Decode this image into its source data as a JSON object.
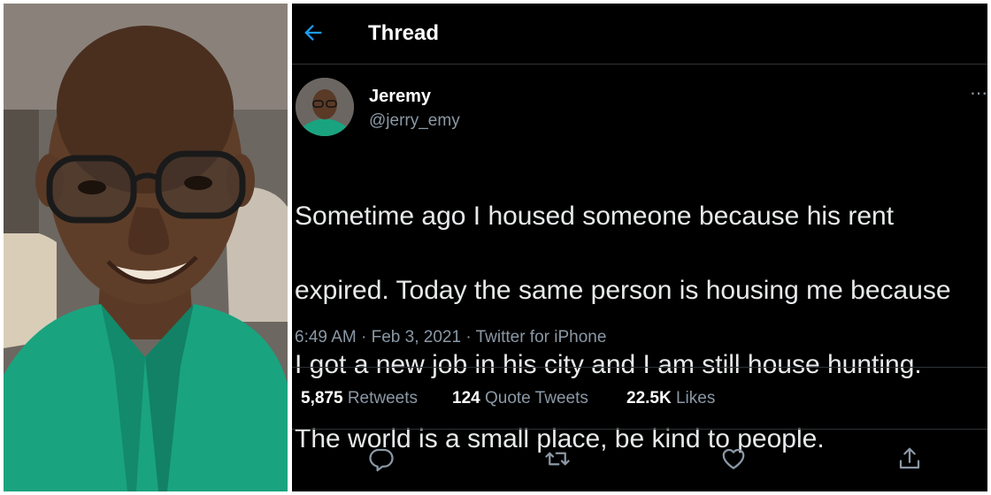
{
  "header": {
    "title": "Thread",
    "back_icon": "arrow-left-icon"
  },
  "author": {
    "display_name": "Jeremy",
    "handle": "@jerry_emy"
  },
  "tweet": {
    "text_lines": [
      "Sometime ago I housed someone because his rent",
      "expired. Today the same person is housing me because",
      "I got a new job in his city and I am still house hunting.",
      "The world is a small place, be kind to people."
    ],
    "time": "6:49 AM",
    "separator": "·",
    "date": "Feb 3, 2021",
    "source": "Twitter for iPhone"
  },
  "stats": {
    "retweets": {
      "count": "5,875",
      "label": "Retweets"
    },
    "quotes": {
      "count": "124",
      "label": "Quote Tweets"
    },
    "likes": {
      "count": "22.5K",
      "label": "Likes"
    }
  },
  "actions": [
    "reply-icon",
    "retweet-icon",
    "like-icon",
    "share-icon"
  ],
  "colors": {
    "background": "#000000",
    "accent": "#1d9bf0",
    "secondary_text": "#8b98a5",
    "divider": "#2f3336",
    "shirt": "#1aa37f"
  }
}
